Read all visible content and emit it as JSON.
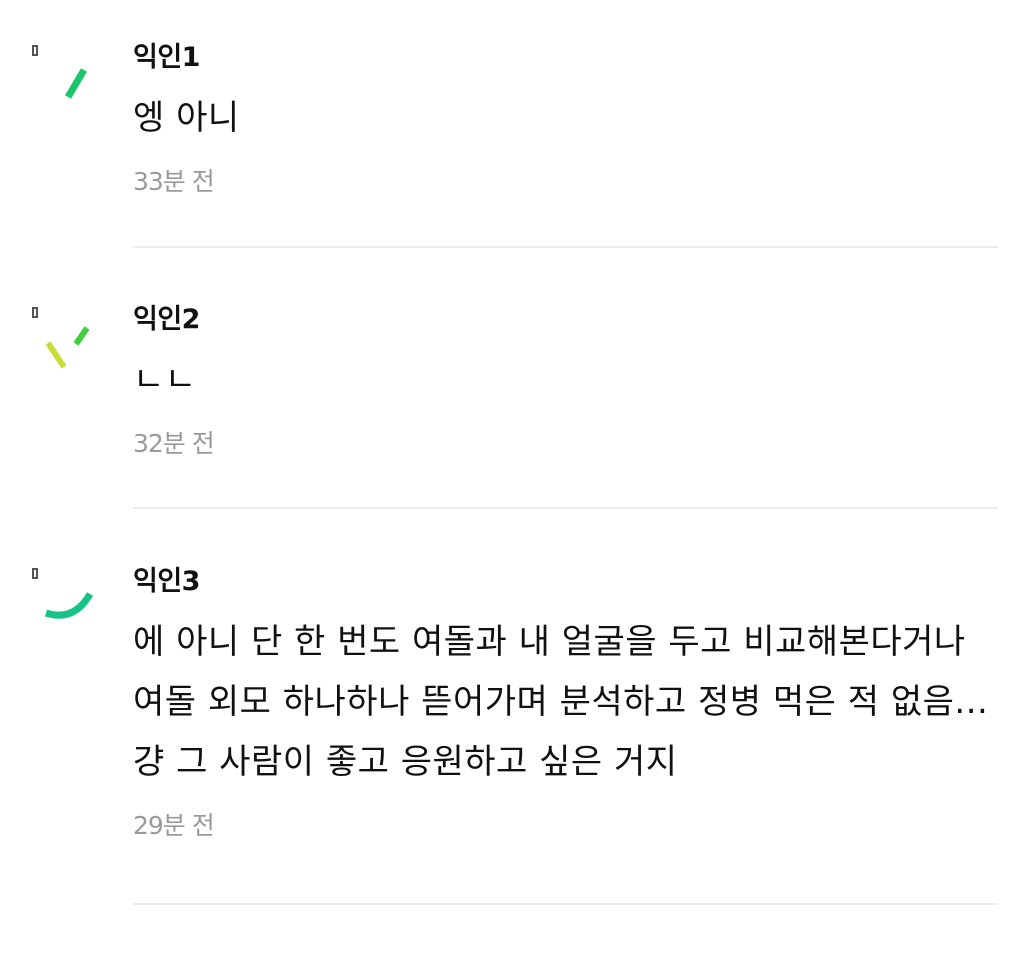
{
  "comments": [
    {
      "author": "익인1",
      "text": "엥 아니",
      "time": "33분 전",
      "avatar_icon": "loading-spinner-icon",
      "avatar_colors": [
        "#1cc46a"
      ]
    },
    {
      "author": "익인2",
      "text": "ㄴㄴ",
      "time": "32분 전",
      "avatar_icon": "loading-spinner-icon",
      "avatar_colors": [
        "#c9dd3a",
        "#3fcf3f"
      ]
    },
    {
      "author": "익인3",
      "text": "에 아니 단 한 번도 여돌과 내 얼굴을 두고 비교해본다거나 여돌 외모 하나하나 뜯어가며 분석하고 정병 먹은 적 없음... 걍 그 사람이 좋고 응원하고 싶은 거지",
      "time": "29분 전",
      "avatar_icon": "loading-spinner-icon",
      "avatar_colors": [
        "#16c48a"
      ]
    }
  ]
}
